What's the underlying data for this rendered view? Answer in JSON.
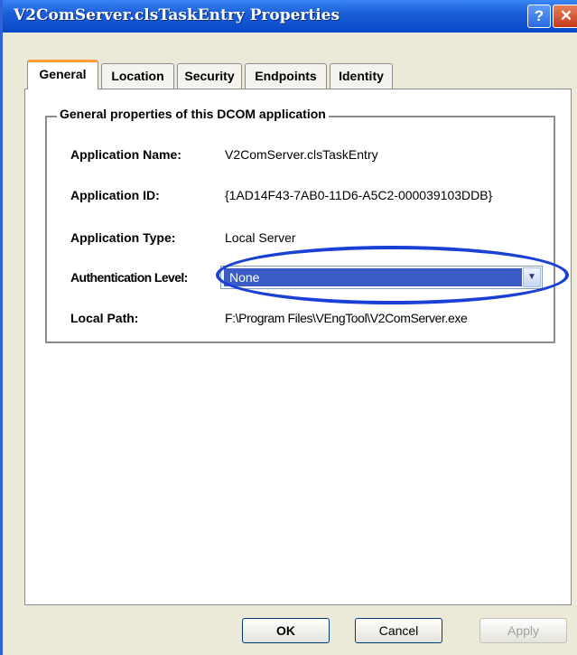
{
  "window": {
    "title": "V2ComServer.clsTaskEntry Properties",
    "help_label": "?",
    "close_label": "✕"
  },
  "tabs": [
    {
      "label": "General",
      "active": true
    },
    {
      "label": "Location",
      "active": false
    },
    {
      "label": "Security",
      "active": false
    },
    {
      "label": "Endpoints",
      "active": false
    },
    {
      "label": "Identity",
      "active": false
    }
  ],
  "group": {
    "title": "General properties of this DCOM application",
    "rows": [
      {
        "label": "Application Name:",
        "value": "V2ComServer.clsTaskEntry"
      },
      {
        "label": "Application ID:",
        "value": "{1AD14F43-7AB0-11D6-A5C2-000039103DDB}"
      },
      {
        "label": "Application Type:",
        "value": "Local Server"
      },
      {
        "label": "Authentication Level:",
        "value": "None"
      },
      {
        "label": "Local Path:",
        "value": "F:\\Program Files\\VEngTool\\V2ComServer.exe"
      }
    ]
  },
  "buttons": {
    "ok": "OK",
    "cancel": "Cancel",
    "apply": "Apply"
  },
  "colors": {
    "titlebar": "#0a49c9",
    "selection": "#3b5cc6",
    "annotation_ellipse": "#1a3fd4",
    "active_tab_accent": "#ff9b32"
  }
}
